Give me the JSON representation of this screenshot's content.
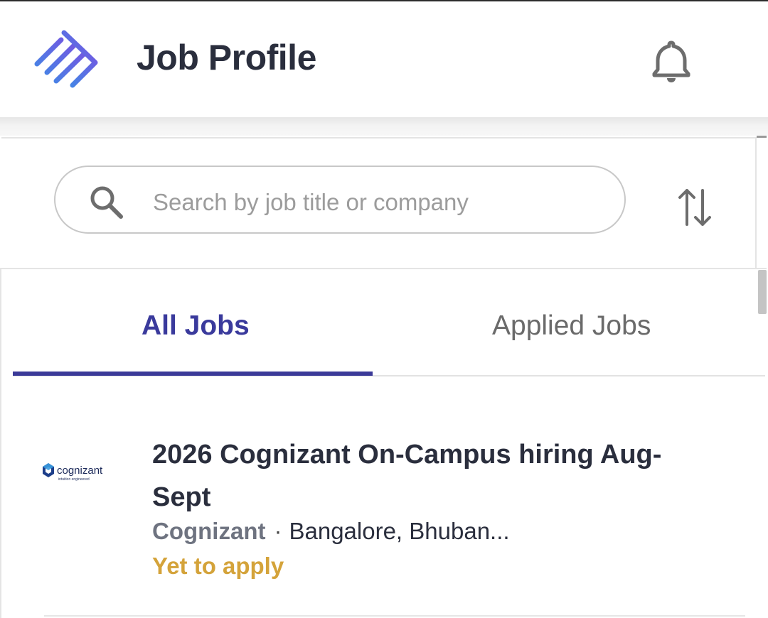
{
  "header": {
    "title": "Job Profile",
    "logo_icon": "brand-stripes-logo",
    "notification_icon": "bell-icon"
  },
  "search": {
    "placeholder": "Search by job title or company",
    "search_icon": "search-icon",
    "sort_icon": "sort-arrows-icon"
  },
  "tabs": [
    {
      "label": "All Jobs",
      "active": true
    },
    {
      "label": "Applied Jobs",
      "active": false
    }
  ],
  "jobs": [
    {
      "title": "2026 Cognizant On-Campus hiring Aug-Sept",
      "company": "Cognizant",
      "location": "Bangalore, Bhuban...",
      "status": "Yet to apply",
      "logo_wordmark": "cognizant",
      "logo_tagline": "intuition engineered"
    }
  ],
  "colors": {
    "accent": "#3b3a98",
    "title_text": "#2a2e3d",
    "status_pending": "#d4a33a",
    "muted_text": "#6e7380",
    "logo_blue": "#4a7be8",
    "logo_purple": "#7b4fe0"
  }
}
